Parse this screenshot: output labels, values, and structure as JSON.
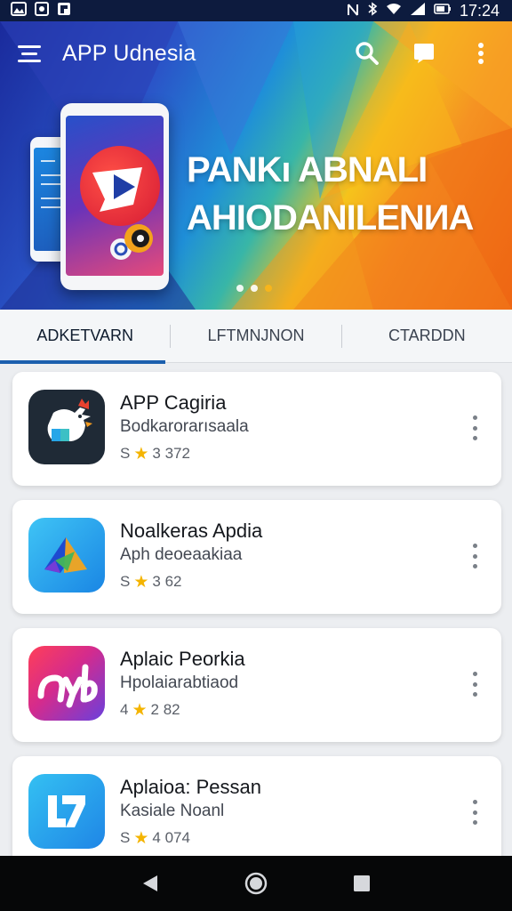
{
  "status_bar": {
    "time": "17:24",
    "left_icons": [
      "gallery-icon",
      "image-icon",
      "flipboard-icon"
    ],
    "right_icons": [
      "nfc-icon",
      "bluetooth-icon",
      "wifi-icon",
      "signal-icon",
      "battery-icon"
    ]
  },
  "app_bar": {
    "title": "APP Udnesia",
    "actions": [
      "search-icon",
      "chat-icon",
      "more-vert-icon"
    ]
  },
  "hero": {
    "headline_line1": "PANKı ABNALI",
    "headline_line2": "AHIODANILENИA",
    "page_indicator_count": 3
  },
  "tabs": [
    {
      "label": "ADKETVARN",
      "active": true
    },
    {
      "label": "LFTMNJNON",
      "active": false
    },
    {
      "label": "CTARDDN",
      "active": false
    }
  ],
  "apps": [
    {
      "name": "APP Cagiria",
      "subtitle": "Bodkarorarısaala",
      "rating_prefix": "S",
      "rating_value": "3 372",
      "icon": "rooster-icon"
    },
    {
      "name": "Noalkeras Apdia",
      "subtitle": "Aph deoeaakiaa",
      "rating_prefix": "S",
      "rating_value": "3 62",
      "icon": "triangle-logo-icon"
    },
    {
      "name": "Aplaic Peorkia",
      "subtitle": "Hpolaiarabtiaod",
      "rating_prefix": "4",
      "rating_value": "2 82",
      "icon": "ayb-logo-icon"
    },
    {
      "name": "Aplaioa: Pessan",
      "subtitle": "Kasiale Noanl",
      "rating_prefix": "S",
      "rating_value": "4 074",
      "icon": "bracket-logo-icon"
    }
  ],
  "nav_bar": [
    "back-icon",
    "home-icon",
    "recents-icon"
  ],
  "colors": {
    "status_bar": "#0d1b3e",
    "tab_indicator": "#1b5fae",
    "star": "#f4b400",
    "nav_bar": "#060708"
  }
}
